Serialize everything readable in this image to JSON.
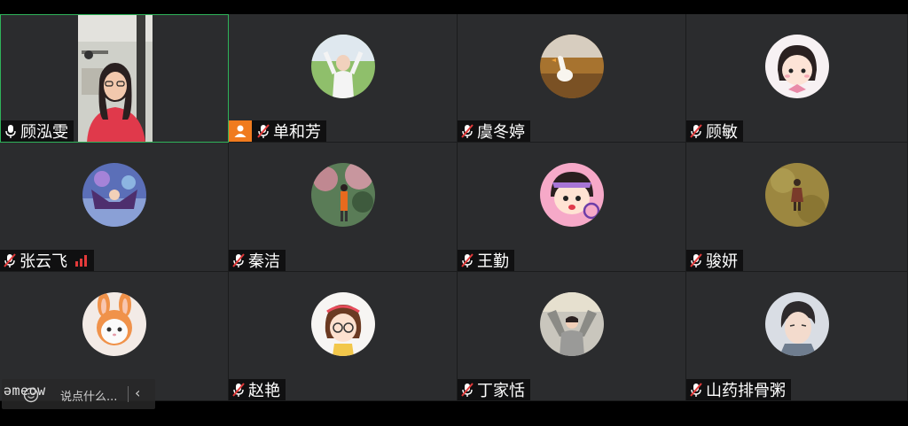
{
  "participants": [
    {
      "name": "顾泓雯",
      "mic": "on",
      "video": true
    },
    {
      "name": "单和芳",
      "mic": "muted",
      "host": true
    },
    {
      "name": "虞冬婷",
      "mic": "muted"
    },
    {
      "name": "顾敏",
      "mic": "muted"
    },
    {
      "name": "张云飞",
      "mic": "muted",
      "signal": "good"
    },
    {
      "name": "秦洁",
      "mic": "muted"
    },
    {
      "name": "王勤",
      "mic": "muted"
    },
    {
      "name": "骏妍",
      "mic": "muted"
    },
    {
      "name": "",
      "mic": "none"
    },
    {
      "name": "赵艳",
      "mic": "muted"
    },
    {
      "name": "丁家恬",
      "mic": "muted"
    },
    {
      "name": "山药排骨粥",
      "mic": "muted"
    }
  ],
  "chat": {
    "brand": "əmeow",
    "placeholder": "说点什么...",
    "collapse_icon": "‹"
  },
  "colors": {
    "tile_bg": "#2b2c2e",
    "active_border": "#2fb35a",
    "host_badge": "#f07b1e",
    "muted_red": "#e23a3a"
  },
  "icons": [
    "mic-on-icon",
    "mic-muted-icon",
    "host-icon",
    "signal-icon",
    "emoji-icon",
    "chevron-left-icon"
  ]
}
